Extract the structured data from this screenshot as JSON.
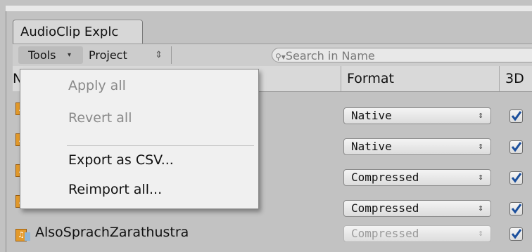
{
  "window": {
    "tab_title": "AudioClip Explc"
  },
  "toolbar": {
    "tools_label": "Tools",
    "tools_arrow": "▾",
    "project_label": "Project",
    "project_arrow": "⇕",
    "search_placeholder": "Search in Name",
    "search_icon_glyph": "⚲▾"
  },
  "table": {
    "headers": {
      "name": "N",
      "format": "Format",
      "three_d": "3D"
    },
    "rows": [
      {
        "name": "",
        "format": "Native",
        "format_enabled": true,
        "three_d": true
      },
      {
        "name": "",
        "format": "Native",
        "format_enabled": true,
        "three_d": true
      },
      {
        "name": "",
        "format": "Compressed",
        "format_enabled": true,
        "three_d": true
      },
      {
        "name": "",
        "format": "Compressed",
        "format_enabled": true,
        "three_d": true
      },
      {
        "name": "AlsoSprachZarathustra",
        "format": "Compressed",
        "format_enabled": false,
        "three_d": true
      }
    ]
  },
  "tools_menu": {
    "items": [
      {
        "label": "Apply all",
        "enabled": false
      },
      {
        "label": "Revert all",
        "enabled": false
      },
      {
        "label": "Export as CSV...",
        "enabled": true
      },
      {
        "label": "Reimport all...",
        "enabled": true
      }
    ]
  },
  "colors": {
    "window_bg": "#c2c2c2",
    "menu_bg": "#f0f0f0",
    "checkmark": "#1b4f9c",
    "icon_orange": "#e39a2b"
  }
}
